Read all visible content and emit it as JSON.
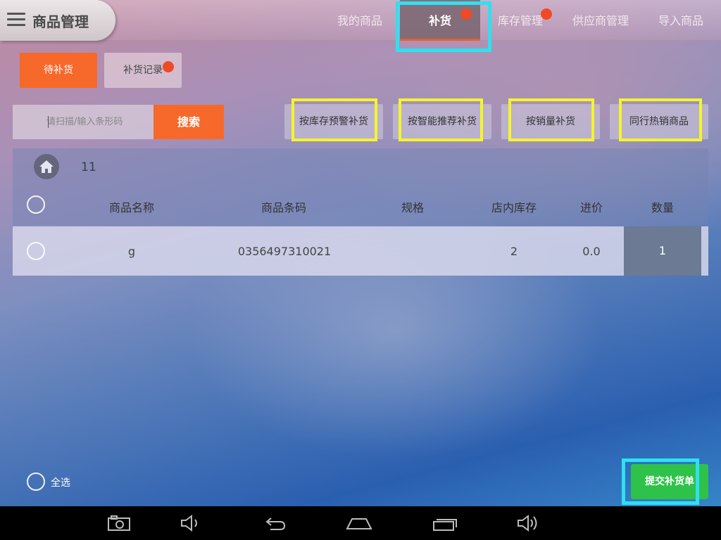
{
  "header": {
    "title": "商品管理",
    "tabs": [
      {
        "label": "我的商品"
      },
      {
        "label": "补货",
        "active": true,
        "badge": true
      },
      {
        "label": "库存管理",
        "badge": true
      },
      {
        "label": "供应商管理"
      },
      {
        "label": "导入商品"
      }
    ]
  },
  "subtabs": {
    "pending": "待补货",
    "records": "补货记录"
  },
  "search": {
    "placeholder": "请扫描/输入条形码",
    "button": "搜索"
  },
  "actions": [
    {
      "label": "按库存预警补货"
    },
    {
      "label": "按智能推荐补货"
    },
    {
      "label": "按销量补货"
    },
    {
      "label": "同行热销商品"
    }
  ],
  "table": {
    "count": "11",
    "columns": [
      "商品名称",
      "商品条码",
      "规格",
      "店内库存",
      "进价",
      "数量"
    ],
    "rows": [
      {
        "name": "g",
        "barcode": "0356497310021",
        "spec": "",
        "stock": "2",
        "price": "0.0",
        "qty": "1"
      }
    ]
  },
  "footer": {
    "select_all": "全选",
    "submit": "提交补货单"
  },
  "colors": {
    "accent": "#f7692a",
    "submit": "#2ec24a",
    "badge": "#ef4a26",
    "highlight_yellow": "#f5f52a",
    "highlight_cyan": "#2fe0f0"
  },
  "icons": [
    "menu-icon",
    "home-icon",
    "camera-icon",
    "volume-down-icon",
    "back-icon",
    "home-nav-icon",
    "recent-apps-icon",
    "volume-up-icon"
  ]
}
